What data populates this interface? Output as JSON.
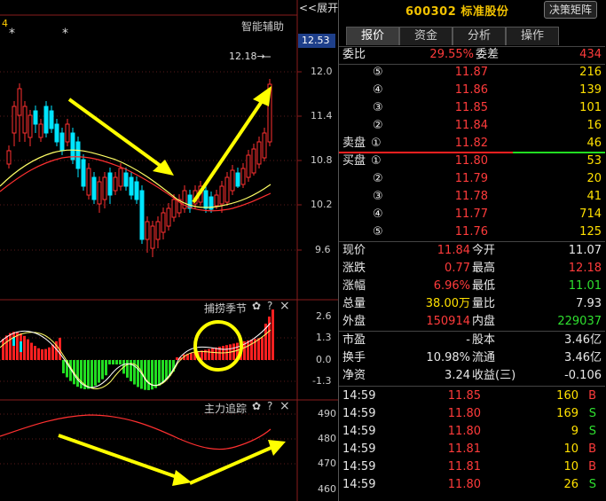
{
  "chart": {
    "expand_label": "<<展开",
    "top_left_digit": "4",
    "stars": [
      "*",
      "*"
    ],
    "assist_label": "智能辅助",
    "price_marker": "12.53",
    "high_annotation": "12.18→",
    "price_ticks": [
      "12.0",
      "11.4",
      "10.8",
      "10.2",
      "9.6"
    ],
    "indicator1": {
      "name": "捕捞季节",
      "ticks": [
        "2.6",
        "1.3",
        "0.0",
        "-1.3"
      ]
    },
    "indicator2": {
      "name": "主力追踪",
      "ticks": [
        "490",
        "480",
        "470",
        "460"
      ]
    },
    "icons": [
      "gear-icon",
      "help-icon",
      "close-icon"
    ],
    "help_char": "?",
    "close_char": "×",
    "gear_char": "✿",
    "colors": {
      "up": "#ff3030",
      "down": "#00e5ff",
      "ma1": "#ffff66",
      "ma2": "#ff3030",
      "bar_up": "#ff2020",
      "bar_down": "#22dd22",
      "arrow": "#ffff00"
    }
  },
  "chart_data": {
    "type": "candlestick",
    "price_axis": [
      9.6,
      10.2,
      10.8,
      11.4,
      12.0
    ],
    "annotated_high": 12.18,
    "current_price_marker": 12.53
  },
  "quote": {
    "code": "600302",
    "name": "标准股份",
    "decision_button": "决策矩阵",
    "tabs": [
      "报价",
      "资金",
      "分析",
      "操作"
    ],
    "weibi": {
      "label": "委比",
      "value": "29.55%",
      "diff_label": "委差",
      "diff": "434"
    },
    "sell_title": "卖盘",
    "buy_title": "买盘",
    "sell": [
      {
        "level": "⑤",
        "price": "11.87",
        "vol": "216"
      },
      {
        "level": "④",
        "price": "11.86",
        "vol": "139"
      },
      {
        "level": "③",
        "price": "11.85",
        "vol": "101"
      },
      {
        "level": "②",
        "price": "11.84",
        "vol": "16"
      },
      {
        "level": "①",
        "price": "11.82",
        "vol": "46"
      }
    ],
    "buy": [
      {
        "level": "①",
        "price": "11.80",
        "vol": "53"
      },
      {
        "level": "②",
        "price": "11.79",
        "vol": "20"
      },
      {
        "level": "③",
        "price": "11.78",
        "vol": "41"
      },
      {
        "level": "④",
        "price": "11.77",
        "vol": "714"
      },
      {
        "level": "⑤",
        "price": "11.76",
        "vol": "125"
      }
    ],
    "stats": [
      {
        "l1": "现价",
        "v1": "11.84",
        "c1": "red",
        "l2": "今开",
        "v2": "11.07",
        "c2": "white"
      },
      {
        "l1": "涨跌",
        "v1": "0.77",
        "c1": "red",
        "l2": "最高",
        "v2": "12.18",
        "c2": "red"
      },
      {
        "l1": "涨幅",
        "v1": "6.96%",
        "c1": "red",
        "l2": "最低",
        "v2": "11.01",
        "c2": "green"
      },
      {
        "l1": "总量",
        "v1": "38.00万",
        "c1": "yellow",
        "l2": "量比",
        "v2": "7.93",
        "c2": "white"
      },
      {
        "l1": "外盘",
        "v1": "150914",
        "c1": "red",
        "l2": "内盘",
        "v2": "229037",
        "c2": "green"
      }
    ],
    "stats2": [
      {
        "l1": "市盈",
        "v1": "-",
        "l2": "股本",
        "v2": "3.46亿"
      },
      {
        "l1": "换手",
        "v1": "10.98%",
        "l2": "流通",
        "v2": "3.46亿"
      },
      {
        "l1": "净资",
        "v1": "3.24",
        "l2": "收益(三)",
        "v2": "-0.106"
      }
    ],
    "ticks": [
      {
        "time": "14:59",
        "price": "11.85",
        "vol": "160",
        "side": "B"
      },
      {
        "time": "14:59",
        "price": "11.80",
        "vol": "169",
        "side": "S"
      },
      {
        "time": "14:59",
        "price": "11.80",
        "vol": "9",
        "side": "S"
      },
      {
        "time": "14:59",
        "price": "11.81",
        "vol": "10",
        "side": "B"
      },
      {
        "time": "14:59",
        "price": "11.81",
        "vol": "10",
        "side": "B"
      },
      {
        "time": "14:59",
        "price": "11.80",
        "vol": "26",
        "side": "S"
      }
    ]
  }
}
